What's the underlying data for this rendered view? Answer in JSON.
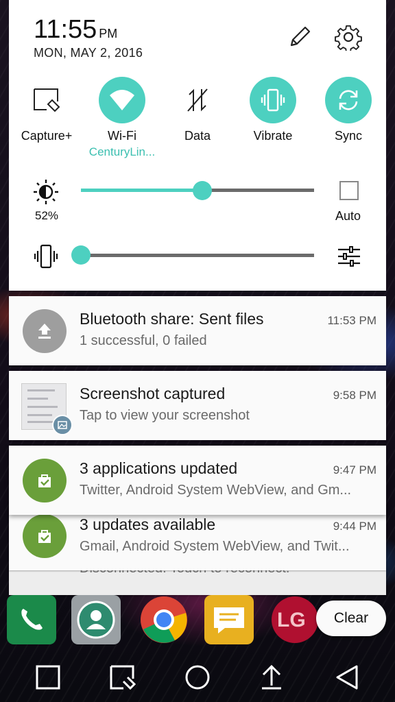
{
  "status": {
    "time": "11:55",
    "ampm": "PM",
    "date": "MON, MAY 2, 2016"
  },
  "header_icons": [
    "edit-icon",
    "settings-icon"
  ],
  "toggles": [
    {
      "label": "Capture+",
      "sub": "",
      "icon": "capture-plus-icon",
      "on": false
    },
    {
      "label": "Wi-Fi",
      "sub": "CenturyLin...",
      "icon": "wifi-icon",
      "on": true
    },
    {
      "label": "Data",
      "sub": "",
      "icon": "data-off-icon",
      "on": false
    },
    {
      "label": "Vibrate",
      "sub": "",
      "icon": "vibrate-icon",
      "on": true
    },
    {
      "label": "Sync",
      "sub": "",
      "icon": "sync-icon",
      "on": true
    }
  ],
  "brightness": {
    "percent_label": "52%",
    "level": 0.52,
    "auto_label": "Auto",
    "auto_checked": false
  },
  "volume": {
    "level": 0.0
  },
  "notifications": [
    {
      "title": "Bluetooth share: Sent files",
      "body": "1 successful, 0 failed",
      "time": "11:53 PM",
      "icon": "upload-icon"
    },
    {
      "title": "Screenshot captured",
      "body": "Tap to view your screenshot",
      "time": "9:58 PM",
      "icon": "screenshot-thumbnail"
    },
    {
      "title": "3 applications updated",
      "body": "Twitter, Android System WebView, and Gm...",
      "time": "9:47 PM",
      "icon": "play-store-update-icon"
    },
    {
      "title": "3 updates available",
      "body": "Gmail, Android System WebView, and Twit...",
      "time": "9:44 PM",
      "icon": "play-store-update-icon"
    }
  ],
  "hidden_notification_text": "Disconnected. Touch to reconnect.",
  "clear_label": "Clear",
  "dock_logo": "LG",
  "colors": {
    "accent": "#4dd0c0",
    "play_green": "#6a9f3a",
    "bt_gray": "#9e9e9e"
  }
}
